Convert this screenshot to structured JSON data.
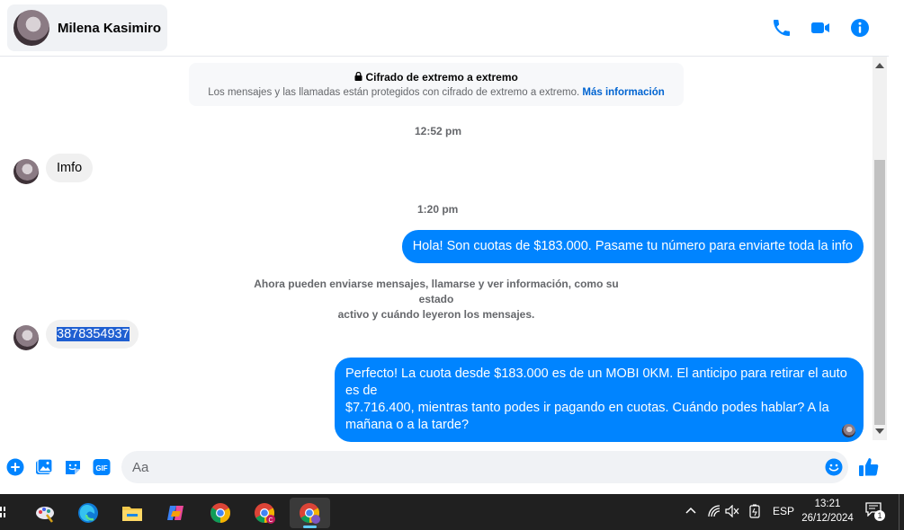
{
  "header": {
    "contact_name": "Milena Kasimiro"
  },
  "encryption": {
    "title": "Cifrado de extremo a extremo",
    "subtitle": "Los mensajes y las llamadas están protegidos con cifrado de extremo a extremo.",
    "link": "Más información"
  },
  "messages": [
    {
      "type": "time",
      "text": "12:52 pm"
    },
    {
      "type": "in",
      "text": "Imfo"
    },
    {
      "type": "time",
      "text": "1:20 pm"
    },
    {
      "type": "out",
      "text": "Hola! Son cuotas de $183.000. Pasame tu número para enviarte toda la info"
    },
    {
      "type": "notice",
      "line1": "Ahora pueden enviarse mensajes, llamarse y ver información, como su estado",
      "line2": "activo y cuándo leyeron los mensajes."
    },
    {
      "type": "in",
      "text": "3878354937"
    },
    {
      "type": "out",
      "line1": "Perfecto! La cuota desde $183.000 es de un MOBI 0KM. El anticipo para retirar el auto es de",
      "line2": "$7.716.400, mientras tanto podes ir pagando en cuotas. Cuándo podes hablar? A la",
      "line3": "mañana o a la tarde?"
    }
  ],
  "composer": {
    "placeholder": "Aa"
  },
  "icons": {
    "header": [
      "phone-icon",
      "video-call-icon",
      "info-icon"
    ],
    "composer": [
      "plus-icon",
      "photo-icon",
      "sticker-icon",
      "gif-icon",
      "emoji-icon",
      "thumbs-up-icon"
    ]
  },
  "taskbar": {
    "language": "ESP",
    "time": "13:21",
    "date": "26/12/2024",
    "notification_count": "1"
  },
  "colors": {
    "accent": "#0084ff",
    "incoming_bubble": "#f0f0f0",
    "taskbar": "#202020"
  }
}
